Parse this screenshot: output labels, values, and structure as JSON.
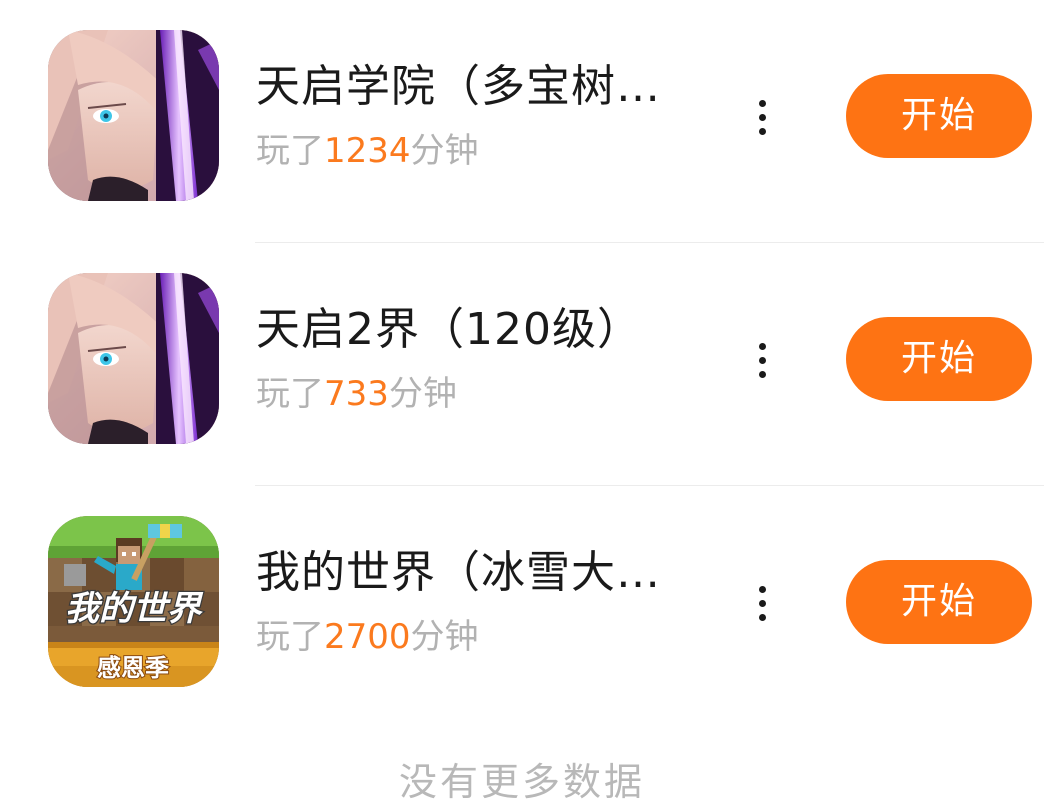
{
  "games": [
    {
      "title": "天启学院（多宝树…",
      "played_prefix": "玩了",
      "minutes": "1234",
      "played_suffix": "分钟",
      "button_label": "开始",
      "icon": "anime-character-icon"
    },
    {
      "title": "天启2界（120级）",
      "played_prefix": "玩了",
      "minutes": "733",
      "played_suffix": "分钟",
      "button_label": "开始",
      "icon": "anime-character-icon"
    },
    {
      "title": "我的世界（冰雪大…",
      "played_prefix": "玩了",
      "minutes": "2700",
      "played_suffix": "分钟",
      "button_label": "开始",
      "icon": "minecraft-icon",
      "icon_text": {
        "logo": "我的世界",
        "banner": "感恩季"
      }
    }
  ],
  "footer": {
    "text": "没有更多数据"
  },
  "colors": {
    "accent": "#fe7313",
    "minutes_highlight": "#fb7a1e",
    "secondary_text": "#b2b2b2",
    "title_text": "#1a1a1a"
  }
}
